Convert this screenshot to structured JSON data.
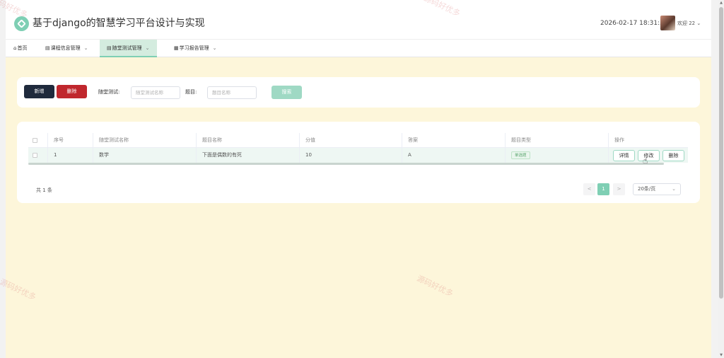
{
  "header": {
    "title": "基于django的智慧学习平台设计与实现",
    "datetime": "2026-02-17 18:31:57",
    "welcome": "欢迎 22",
    "brand_color": "#7fcfb4"
  },
  "nav": {
    "items": [
      {
        "label": "首页",
        "icon": "home-icon",
        "has_dropdown": false,
        "active": false
      },
      {
        "label": "课程信息管理",
        "icon": "list-icon",
        "has_dropdown": true,
        "active": false
      },
      {
        "label": "随堂测试管理",
        "icon": "list-icon",
        "has_dropdown": true,
        "active": true
      },
      {
        "label": "学习报告管理",
        "icon": "grid-icon",
        "has_dropdown": true,
        "active": false
      }
    ]
  },
  "toolbar": {
    "add_label": "新增",
    "delete_label": "删除",
    "search_label": "搜索",
    "test_name_label": "随堂测试:",
    "test_name_placeholder": "随堂测试名称",
    "question_label": "题目:",
    "question_placeholder": "题目名称"
  },
  "table": {
    "columns": [
      "序号",
      "随堂测试名称",
      "题目名称",
      "分值",
      "答案",
      "题目类型",
      "操作"
    ],
    "rows": [
      {
        "index": "1",
        "test_name": "数学",
        "question": "下面是偶数的有死",
        "score": "10",
        "answer": "A",
        "type": "单选题"
      }
    ],
    "actions": {
      "detail": "详情",
      "edit": "修改",
      "delete": "删除"
    }
  },
  "pagination": {
    "total": "共 1 条",
    "prev": "<",
    "current_page": "1",
    "next": ">",
    "page_size": "20条/页"
  },
  "watermark": "源码好优多"
}
